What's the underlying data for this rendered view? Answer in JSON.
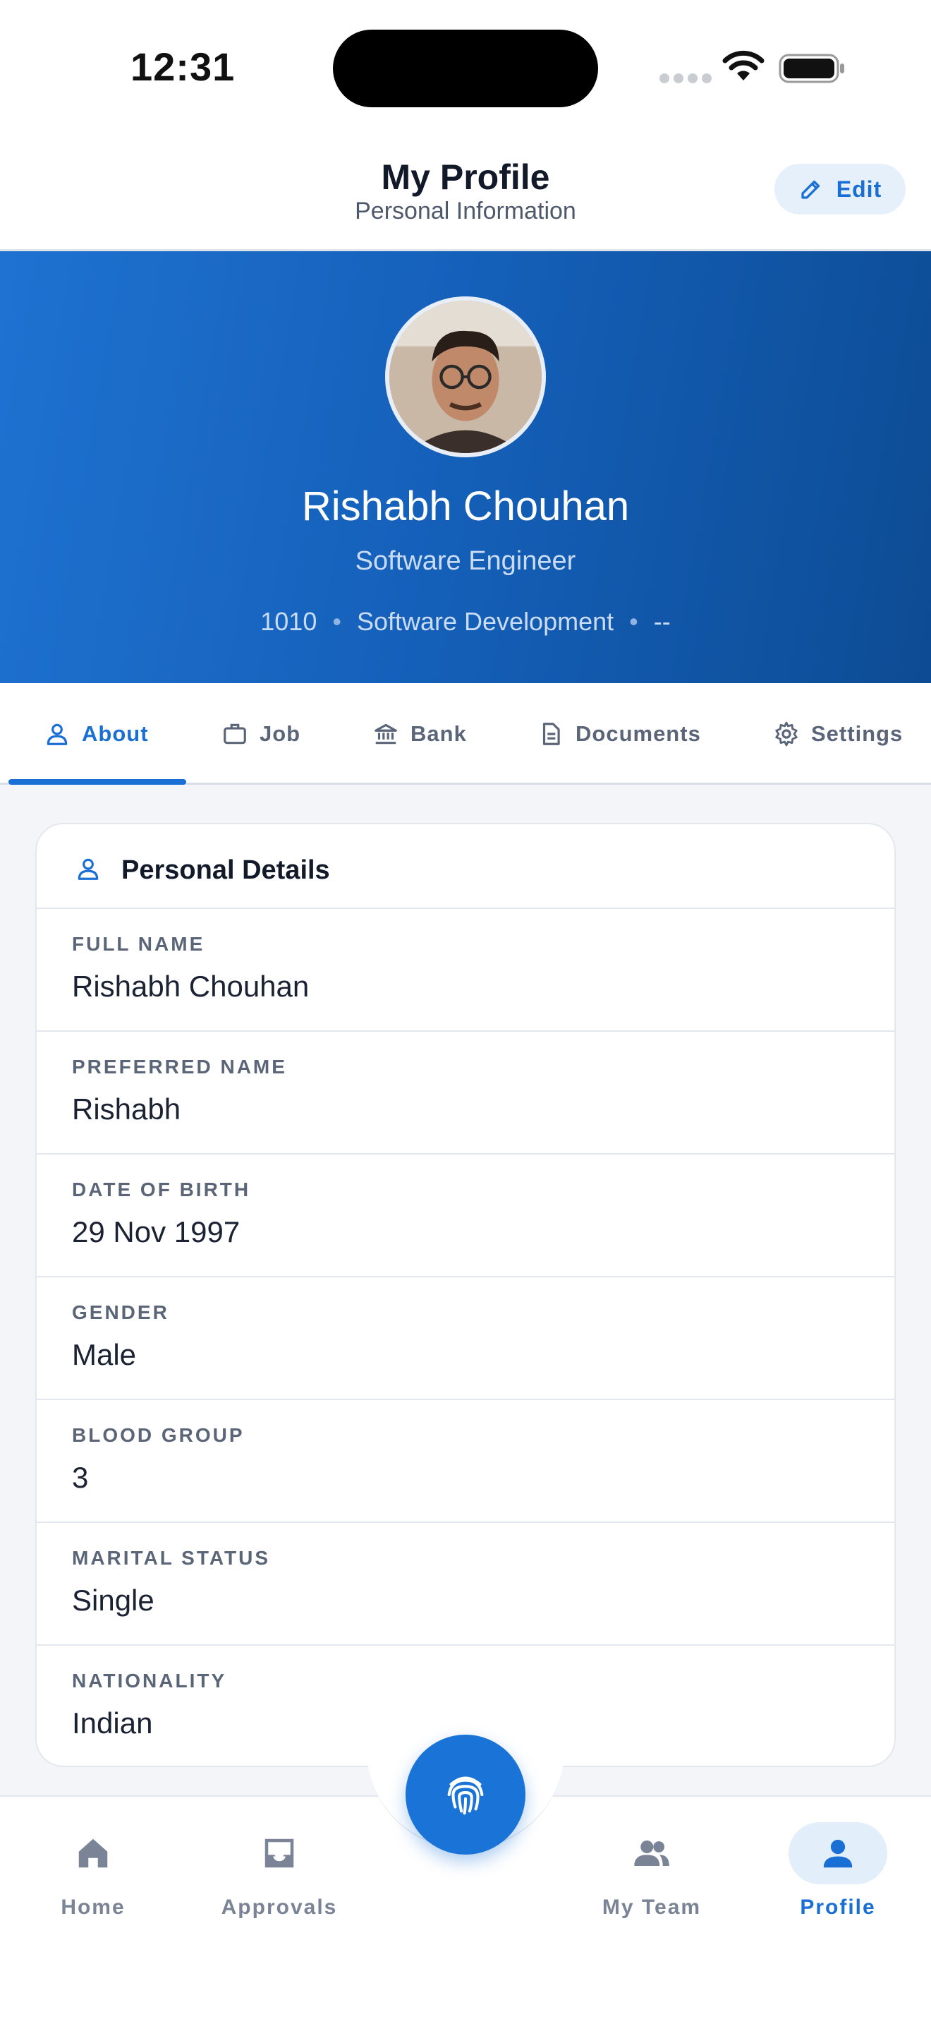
{
  "status_bar": {
    "time": "12:31"
  },
  "header": {
    "title": "My Profile",
    "subtitle": "Personal Information",
    "edit_label": "Edit"
  },
  "profile": {
    "name": "Rishabh Chouhan",
    "role": "Software Engineer",
    "employee_id": "1010",
    "department": "Software Development",
    "extra": "--"
  },
  "tabs": [
    {
      "label": "About",
      "icon": "person-icon",
      "active": true
    },
    {
      "label": "Job",
      "icon": "briefcase-icon",
      "active": false
    },
    {
      "label": "Bank",
      "icon": "bank-icon",
      "active": false
    },
    {
      "label": "Documents",
      "icon": "document-icon",
      "active": false
    },
    {
      "label": "Settings",
      "icon": "gear-icon",
      "active": false
    }
  ],
  "personal_details": {
    "title": "Personal Details",
    "fields": [
      {
        "label": "FULL NAME",
        "value": "Rishabh Chouhan"
      },
      {
        "label": "PREFERRED NAME",
        "value": "Rishabh"
      },
      {
        "label": "DATE OF BIRTH",
        "value": "29 Nov 1997"
      },
      {
        "label": "GENDER",
        "value": "Male"
      },
      {
        "label": "BLOOD GROUP",
        "value": "3"
      },
      {
        "label": "MARITAL STATUS",
        "value": "Single"
      },
      {
        "label": "NATIONALITY",
        "value": "Indian"
      }
    ]
  },
  "bottom_nav": [
    {
      "label": "Home",
      "icon": "home-icon",
      "active": false
    },
    {
      "label": "Approvals",
      "icon": "inbox-icon",
      "active": false
    },
    {
      "label": "My Team",
      "icon": "team-icon",
      "active": false
    },
    {
      "label": "Profile",
      "icon": "person-icon",
      "active": true
    }
  ],
  "fab": {
    "icon": "fingerprint-icon"
  },
  "colors": {
    "accent": "#1a6fd4",
    "hero_start": "#1f72d1",
    "hero_end": "#0d4c94"
  }
}
